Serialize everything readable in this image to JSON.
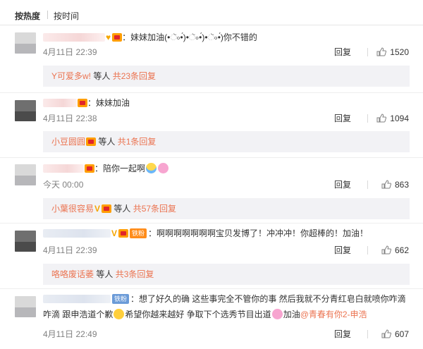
{
  "tabs": {
    "hot": "按热度",
    "time": "按时间"
  },
  "comments": [
    {
      "text": "：妹妹加油(•ૅ৹•́)•ૅ৹•́)•ૅ৹•́)你不错的",
      "date": "4月11日 22:39",
      "reply_label": "回复",
      "likes": "1520",
      "replies": {
        "who": "Y可爱多w!",
        "mid": " 等人 ",
        "count": "共23条回复"
      }
    },
    {
      "text": "：妹妹加油",
      "date": "4月11日 22:38",
      "reply_label": "回复",
      "likes": "1094",
      "replies": {
        "who": "小豆圆圆",
        "mid": " 等人 ",
        "count": "共1条回复"
      }
    },
    {
      "text": "：陪你一起啊",
      "date": "今天 00:00",
      "reply_label": "回复",
      "likes": "863",
      "replies": {
        "who": "小葉很容易",
        "mid": " 等人 ",
        "count": "共57条回复"
      }
    },
    {
      "fan_badge": "铁粉",
      "text": "：啊啊啊啊啊啊啊宝贝发博了！冲冲冲！你超棒的！加油！",
      "date": "4月11日 22:39",
      "reply_label": "回复",
      "likes": "662",
      "replies": {
        "who": "咯咯废话萎",
        "mid": " 等人 ",
        "count": "共3条回复"
      }
    },
    {
      "fan_badge": "铁粉",
      "text_line1": "：想了好久的确 这些事完全不管你的事  然后我就不分青红皂白就喷你咋滴",
      "text_line2a": "咋滴  跟申浩道个歉",
      "text_line2b": "希望你越来越好  争取下个选秀节目出道",
      "text_line2c": "加油",
      "mention": "@青春有你2-申浩",
      "date": "4月11日 22:49",
      "reply_label": "回复",
      "likes": "607"
    }
  ],
  "colors": {
    "accent": "#eb7350",
    "vip": "#ff9d00",
    "fan_badge": "#ff8c1a"
  }
}
